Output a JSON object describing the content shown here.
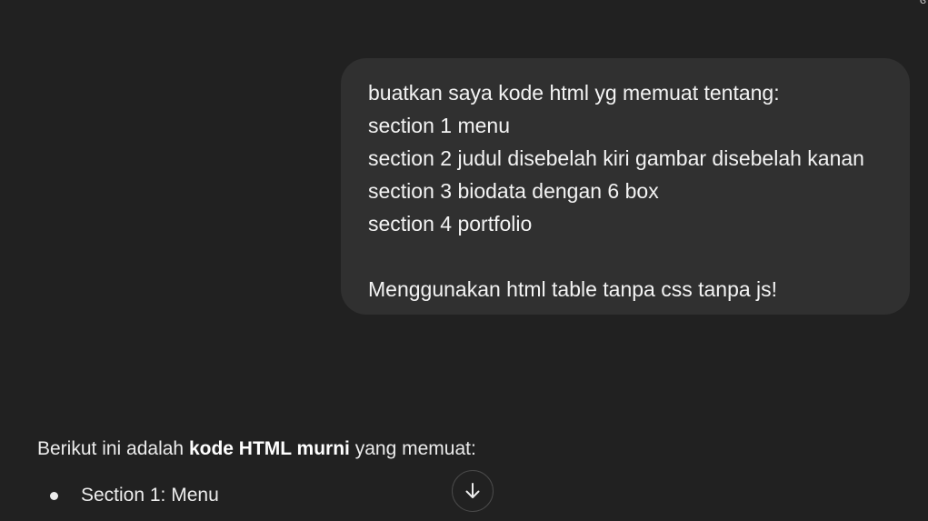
{
  "user_message": {
    "lines": [
      "buatkan saya kode html yg memuat tentang:",
      "section 1 menu",
      "section 2 judul disebelah kiri gambar disebelah kanan",
      "section 3 biodata dengan 6 box",
      "section 4 portfolio",
      "Menggunakan html table tanpa css tanpa js!"
    ]
  },
  "assistant_message": {
    "intro_prefix": "Berikut ini adalah ",
    "intro_bold": "kode HTML murni",
    "intro_suffix": " yang memuat:",
    "bullets": [
      "Section 1: Menu"
    ]
  },
  "scroll_button": {
    "icon": "arrow-down-icon"
  },
  "corner_glyph": "ɞ",
  "colors": {
    "background": "#212121",
    "bubble": "#303030",
    "text": "#ececec"
  }
}
